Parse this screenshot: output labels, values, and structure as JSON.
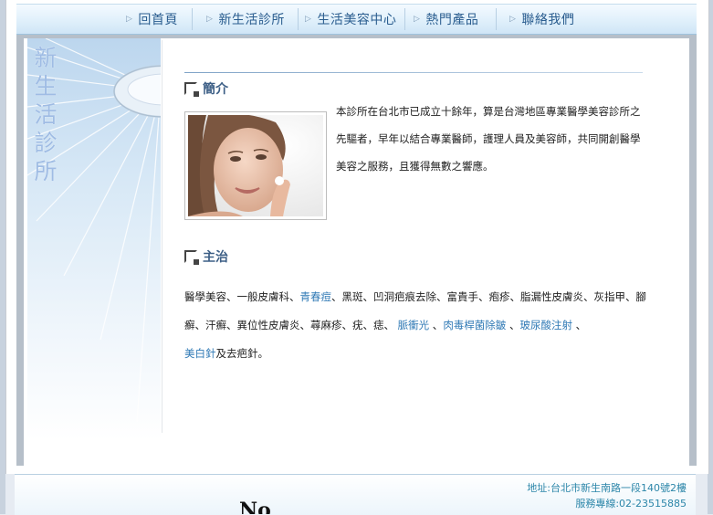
{
  "nav": {
    "items": [
      {
        "label": "回首頁"
      },
      {
        "label": "新生活診所"
      },
      {
        "label": "生活美容中心"
      },
      {
        "label": "熱門產品"
      },
      {
        "label": "聯絡我們"
      }
    ]
  },
  "sidebar": {
    "title_chars": [
      "新",
      "生",
      "活",
      "診",
      "所"
    ]
  },
  "intro": {
    "title": "簡介",
    "text": "本診所在台北市已成立十餘年，算是台灣地區專業醫學美容診所之先驅者，早年以結合專業醫師，護理人員及美容師，共同開創醫學美容之服務，且獲得無數之響應。"
  },
  "treatments": {
    "title": "主治",
    "part1": "醫學美容、一般皮膚科、",
    "link1": "青春痘",
    "part2": "、黑斑、凹洞疤痕去除、富貴手、疱疹、脂漏性皮膚炎、灰指甲、腳癬、汗癬、異位性皮膚炎、蕁麻疹、疣、痣、 ",
    "link2": "脈衝光",
    "sep1": " 、",
    "link3": "肉毒桿菌除皺",
    "sep2": " 、",
    "link4": "玻尿酸注射",
    "sep3": " 、",
    "link5": "美白針",
    "part3": "及去疤針。"
  },
  "footer": {
    "address": "地址:台北市新生南路一段140號2樓",
    "phone": "服務專線:02-23515885",
    "fragment": "No"
  },
  "colors": {
    "nav_text": "#2a5d8f",
    "link": "#2f79b5",
    "footer_text": "#2c86a9",
    "section_title": "#3d5f86"
  }
}
